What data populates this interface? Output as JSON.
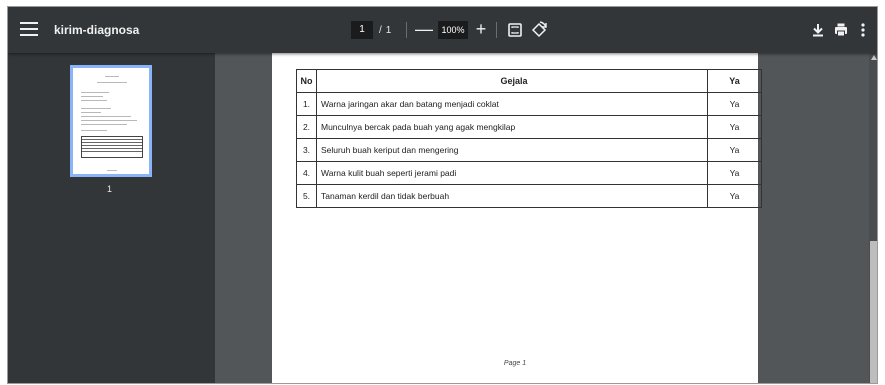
{
  "toolbar": {
    "title": "kirim-diagnosa",
    "current_page": "1",
    "page_separator": "/",
    "total_pages": "1",
    "zoom_minus": "—",
    "zoom_level": "100%",
    "zoom_plus": "+",
    "icons": [
      "menu-icon",
      "fit-page-icon",
      "rotate-icon",
      "download-icon",
      "print-icon",
      "more-vert-icon"
    ]
  },
  "sidebar": {
    "thumbnail_label": "1"
  },
  "document": {
    "table": {
      "headers": [
        "No",
        "Gejala",
        "Ya"
      ],
      "rows": [
        {
          "no": "1.",
          "gejala": "Warna jaringan akar dan batang menjadi coklat",
          "ya": "Ya"
        },
        {
          "no": "2.",
          "gejala": "Munculnya bercak pada buah yang agak mengkilap",
          "ya": "Ya"
        },
        {
          "no": "3.",
          "gejala": "Seluruh buah keriput dan mengering",
          "ya": "Ya"
        },
        {
          "no": "4.",
          "gejala": "Warna kulit buah seperti jerami padi",
          "ya": "Ya"
        },
        {
          "no": "5.",
          "gejala": "Tanaman kerdil dan tidak berbuah",
          "ya": "Ya"
        }
      ]
    },
    "footer": "Page 1"
  },
  "colors": {
    "toolbar_bg": "#323639",
    "viewer_bg": "#525659",
    "thumbnail_border": "#8ab4f8"
  }
}
